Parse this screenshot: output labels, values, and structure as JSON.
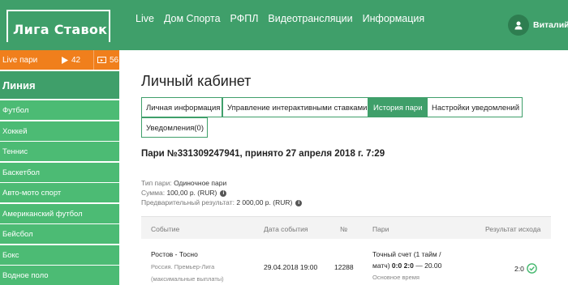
{
  "header": {
    "logo": "Лига Ставок",
    "nav": [
      "Live",
      "Дом Спорта",
      "РФПЛ",
      "Видеотрансляции",
      "Информация"
    ],
    "user_name": "Виталий"
  },
  "sidebar": {
    "live_label": "Live пари",
    "live_video_count": "42",
    "live_tv_count": "56",
    "line_title": "Линия",
    "sports": [
      "Футбол",
      "Хоккей",
      "Теннис",
      "Баскетбол",
      "Авто-мото спорт",
      "Американский футбол",
      "Бейсбол",
      "Бокс",
      "Водное поло"
    ]
  },
  "main": {
    "title": "Личный кабинет",
    "tabs": [
      {
        "label": "Личная информация",
        "active": false
      },
      {
        "label": "Управление интерактивными ставками",
        "active": false
      },
      {
        "label": "История пари",
        "active": true
      },
      {
        "label": "Настройки уведомлений",
        "active": false
      },
      {
        "label": "Уведомления(0)",
        "active": false
      }
    ],
    "bet_heading": "Пари №331309247941, принято 27 апреля 2018 г. 7:29",
    "info": {
      "type_label": "Тип пари:",
      "type_value": "Одиночное пари",
      "sum_label": "Сумма:",
      "sum_value": "100,00 р. (RUR)",
      "result_label": "Предварительный результат:",
      "result_value": "2 000,00 р. (RUR)"
    },
    "table": {
      "headers": [
        "Событие",
        "Дата события",
        "№",
        "Пари",
        "Результат исхода"
      ],
      "row": {
        "event": "Ростов - Тосно",
        "league": "Россия. Премьер-Лига",
        "note": "(максимальные выплаты)",
        "date": "29.04.2018 19:00",
        "number": "12288",
        "bet_line1": "Точный счет (1 тайм /",
        "bet_line2_pre": "матч)",
        "bet_line2_bold": "0:0 2:0",
        "bet_line2_post": "— 20.00",
        "bet_sub": "Основное время",
        "result": "2:0"
      }
    }
  },
  "colors": {
    "green": "#3f9f6a",
    "sport_green": "#4cbb74",
    "orange": "#f07f1c"
  }
}
